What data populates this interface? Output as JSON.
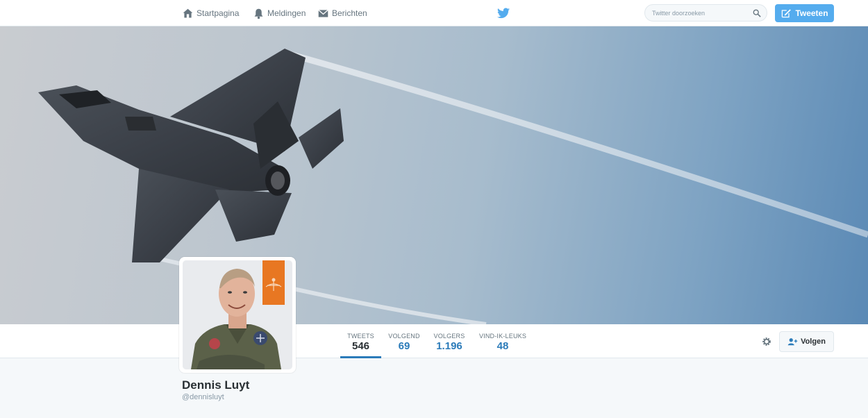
{
  "nav": {
    "home": {
      "label": "Startpagina",
      "icon": "home-icon"
    },
    "notifications": {
      "label": "Meldingen",
      "icon": "bell-icon"
    },
    "messages": {
      "label": "Berichten",
      "icon": "envelope-icon"
    },
    "logo": "twitter-bird-icon",
    "search_placeholder": "Twitter doorzoeken",
    "tweet_button": "Tweeten"
  },
  "banner": {
    "subject": "fighter jet in flight with vapor trail"
  },
  "profile": {
    "name": "Dennis Luyt",
    "handle": "@dennisluyt"
  },
  "stats": [
    {
      "label": "TWEETS",
      "value": "546",
      "active": true
    },
    {
      "label": "VOLGEND",
      "value": "69",
      "active": false
    },
    {
      "label": "VOLGERS",
      "value": "1.196",
      "active": false
    },
    {
      "label": "VIND-IK-LEUKS",
      "value": "48",
      "active": false
    }
  ],
  "actions": {
    "follow_button": "Volgen"
  },
  "colors": {
    "accent": "#55acee",
    "link": "#2b7bb9",
    "badge_orange": "#e87722"
  }
}
